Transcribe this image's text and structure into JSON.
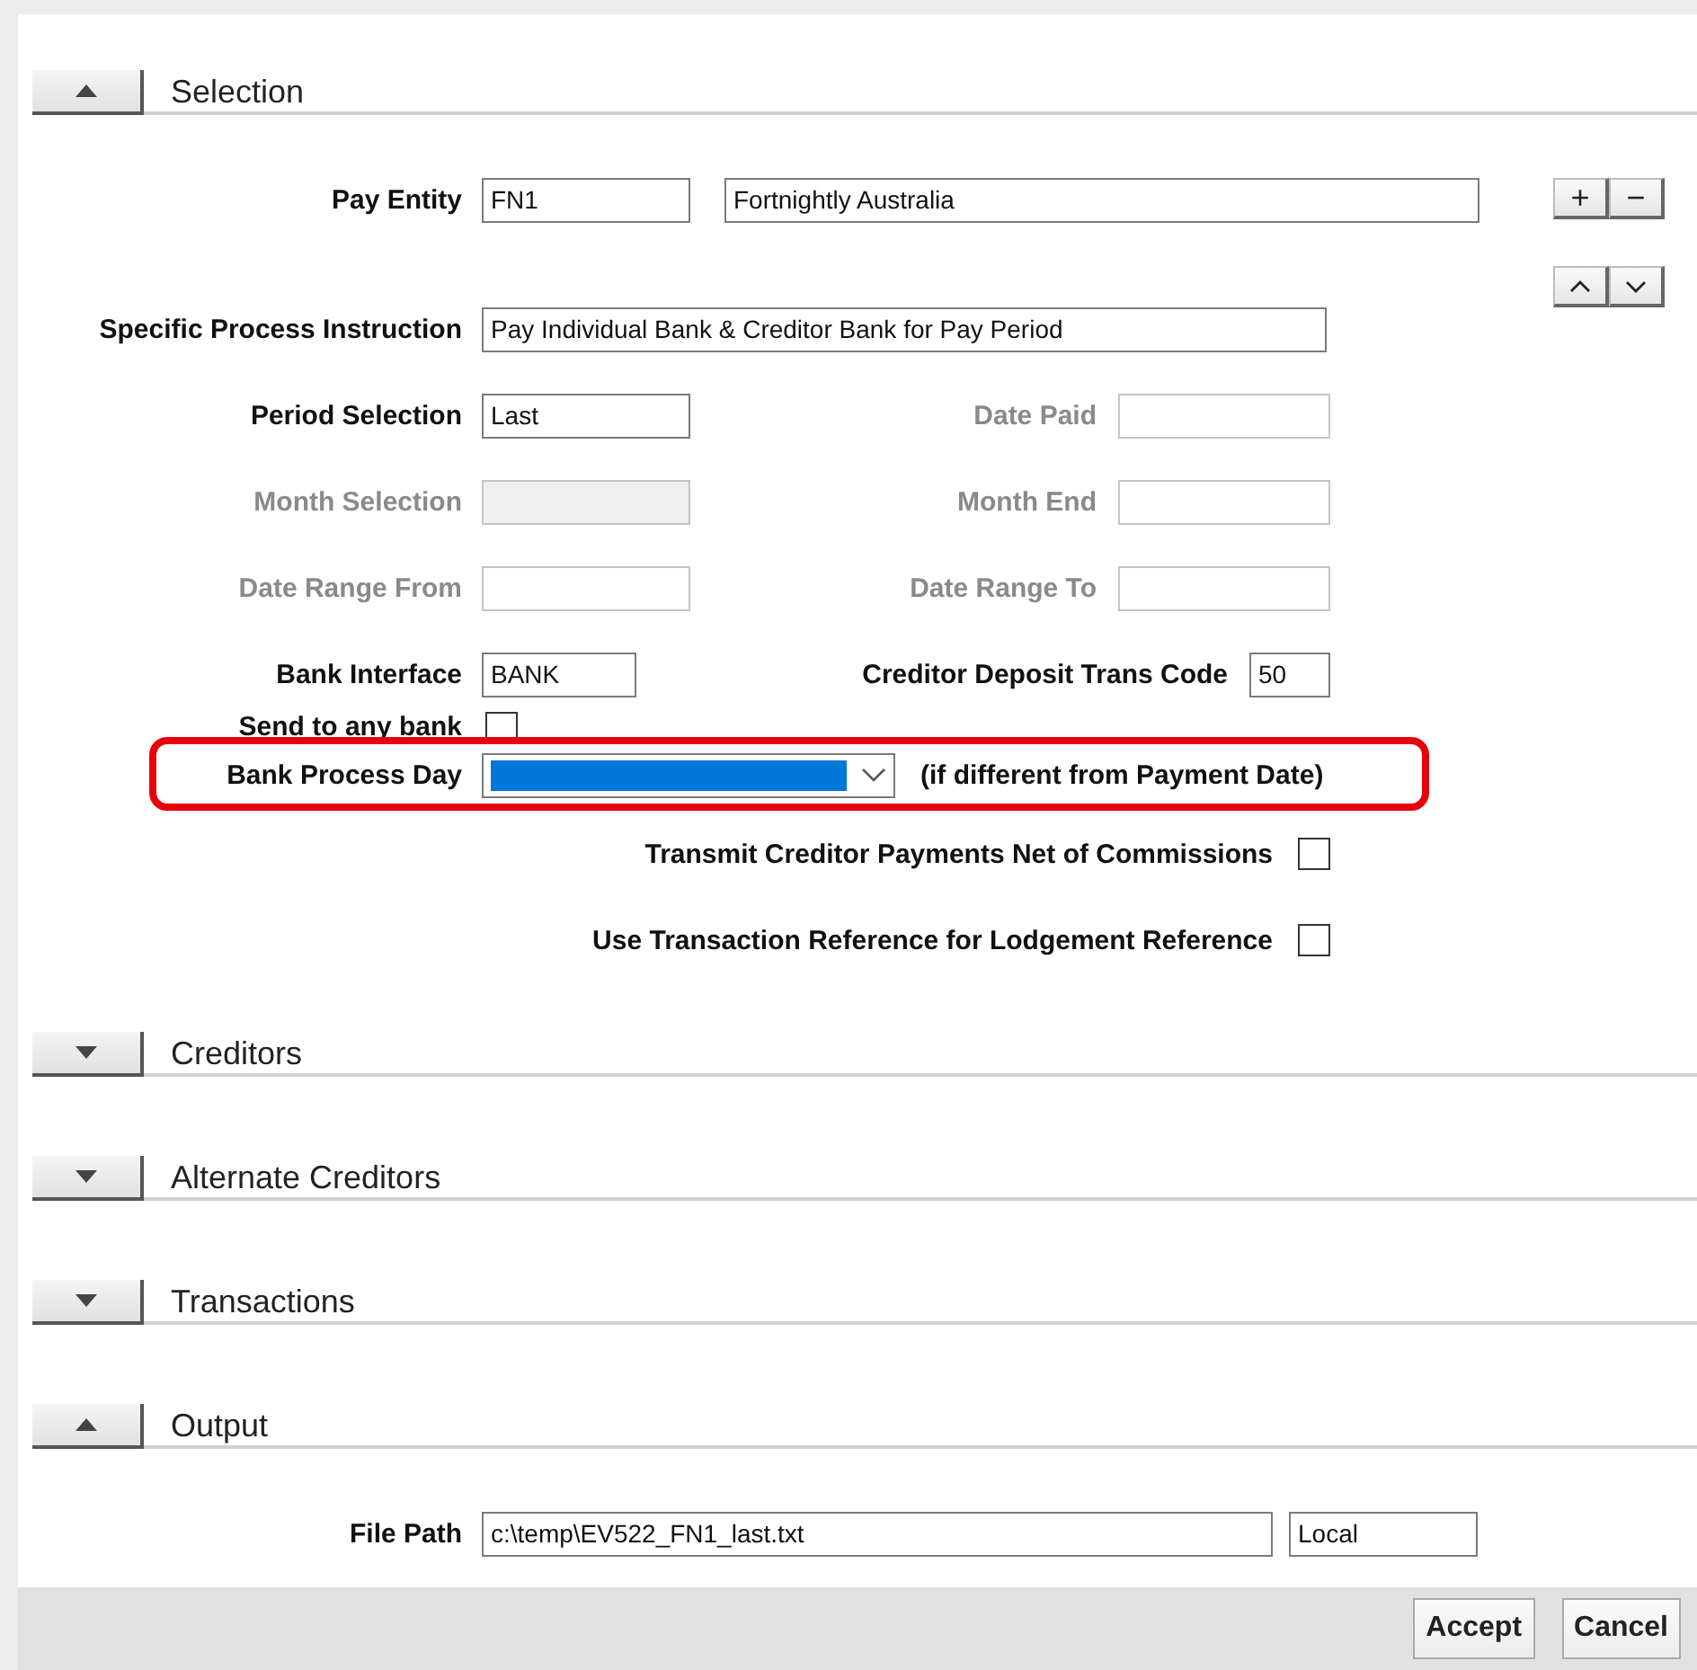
{
  "sections": [
    {
      "title": "Selection",
      "expanded": true,
      "side_buttons": [
        "+",
        "−"
      ],
      "rows": [
        {
          "kind": "entity",
          "label": "Pay Entity",
          "value": "FN1",
          "value_2": "Fortnightly Australia"
        },
        {
          "kind": "text",
          "label": "Specific Process Instruction",
          "value": "Pay Individual Bank & Creditor Bank for Pay Period"
        },
        {
          "kind": "pair",
          "fields": [
            {
              "label": "Period Selection",
              "value": "Last",
              "disabled": false,
              "readonly": false
            },
            {
              "label": "Date Paid",
              "disabled": true,
              "readonly": false
            }
          ]
        },
        {
          "kind": "pair",
          "fields": [
            {
              "label": "Month Selection",
              "disabled": true,
              "readonly": true
            },
            {
              "label": "Month End",
              "disabled": true,
              "readonly": false
            }
          ]
        },
        {
          "kind": "pair",
          "fields": [
            {
              "label": "Date Range From",
              "disabled": true,
              "readonly": false
            },
            {
              "label": "Date Range To",
              "disabled": true,
              "readonly": false
            }
          ]
        },
        {
          "kind": "pair_compact",
          "fields": [
            {
              "label": "Bank Interface",
              "value": "BANK",
              "disabled": false,
              "readonly": false
            },
            {
              "label": "Creditor Deposit Trans Code",
              "value": "50",
              "disabled": false,
              "readonly": false
            }
          ]
        },
        {
          "kind": "checkbox_inline",
          "label": "Send to any bank",
          "checked": false
        },
        {
          "kind": "select",
          "label": "Bank Process Day",
          "focused": true,
          "highlighted": true,
          "note": "(if different from Payment Date)"
        },
        {
          "kind": "checkbox",
          "label": "Transmit Creditor Payments Net of Commissions",
          "checked": false
        },
        {
          "kind": "checkbox",
          "label": "Use Transaction Reference for Lodgement Reference",
          "checked": false
        }
      ]
    },
    {
      "title": "Creditors",
      "expanded": false
    },
    {
      "title": "Alternate Creditors",
      "expanded": false
    },
    {
      "title": "Transactions",
      "expanded": false
    },
    {
      "title": "Output",
      "expanded": true,
      "rows": [
        {
          "kind": "path",
          "label": "File Path",
          "value": "c:\\temp\\EV522_FN1_last.txt",
          "value_2": "Local"
        }
      ]
    }
  ],
  "buttons": [
    "Accept",
    "Cancel"
  ]
}
